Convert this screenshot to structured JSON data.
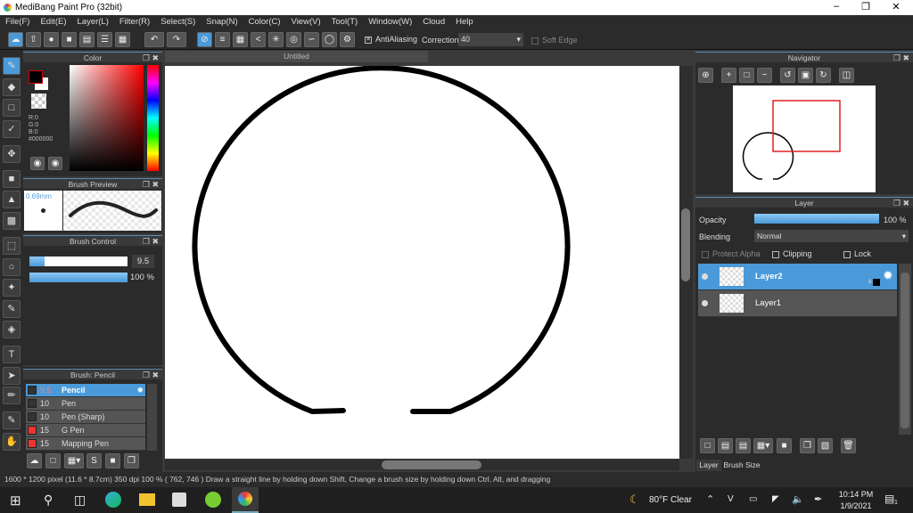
{
  "app": {
    "title": "MediBang Paint Pro (32bit)"
  },
  "menu": [
    "File(F)",
    "Edit(E)",
    "Layer(L)",
    "Filter(R)",
    "Select(S)",
    "Snap(N)",
    "Color(C)",
    "View(V)",
    "Tool(T)",
    "Window(W)",
    "Cloud",
    "Help"
  ],
  "toolbar": {
    "antialiasing_label": "AntiAliasing",
    "antialiasing_checked": true,
    "correction_label": "Correction",
    "correction_value": "40",
    "soft_edge_label": "Soft Edge",
    "soft_edge_checked": false
  },
  "color_panel": {
    "title": "Color",
    "r": "R:0",
    "g": "G:0",
    "b": "B:0",
    "hex": "#000000",
    "primary": "#000000",
    "secondary": "#ffffff"
  },
  "brush_preview": {
    "title": "Brush Preview",
    "size": "0.69mm"
  },
  "brush_control": {
    "title": "Brush Control",
    "size_value": "9.5",
    "opacity_value": "100 %",
    "size_fraction": 0.15,
    "opacity_fraction": 1.0
  },
  "brush_list": {
    "title": "Brush: Pencil",
    "items": [
      {
        "size": "9.5",
        "name": "Pencil",
        "color": "#333333",
        "selected": true
      },
      {
        "size": "10",
        "name": "Pen",
        "color": "#333333"
      },
      {
        "size": "10",
        "name": "Pen (Sharp)",
        "color": "#333333"
      },
      {
        "size": "15",
        "name": "G Pen",
        "color": "#ee3333"
      },
      {
        "size": "15",
        "name": "Mapping Pen",
        "color": "#ee3333"
      }
    ]
  },
  "document": {
    "tab": "Untitled"
  },
  "navigator": {
    "title": "Navigator"
  },
  "layer_panel": {
    "title": "Layer",
    "opacity_label": "Opacity",
    "opacity_value": "100 %",
    "blending_label": "Blending",
    "blending_value": "Normal",
    "protect_alpha": "Protect Alpha",
    "clipping": "Clipping",
    "lock": "Lock",
    "layers": [
      {
        "name": "Layer2",
        "selected": true,
        "bit": "8"
      },
      {
        "name": "Layer1",
        "selected": false
      }
    ]
  },
  "bottom_tabs": [
    "Layer",
    "Brush Size"
  ],
  "status": {
    "text": "1600 * 1200 pixel   (11.6 * 8.7cm)   350 dpi   100 %   ( 762, 746 )   Draw a straight line by holding down Shift, Change a brush size by holding down Ctrl, Alt, and dragging"
  },
  "taskbar": {
    "weather": "80°F  Clear",
    "time": "10:14 PM",
    "date": "1/9/2021",
    "notifications": "1"
  },
  "colors": {
    "accent": "#4a9ad9",
    "panel": "#2b2b2b"
  }
}
